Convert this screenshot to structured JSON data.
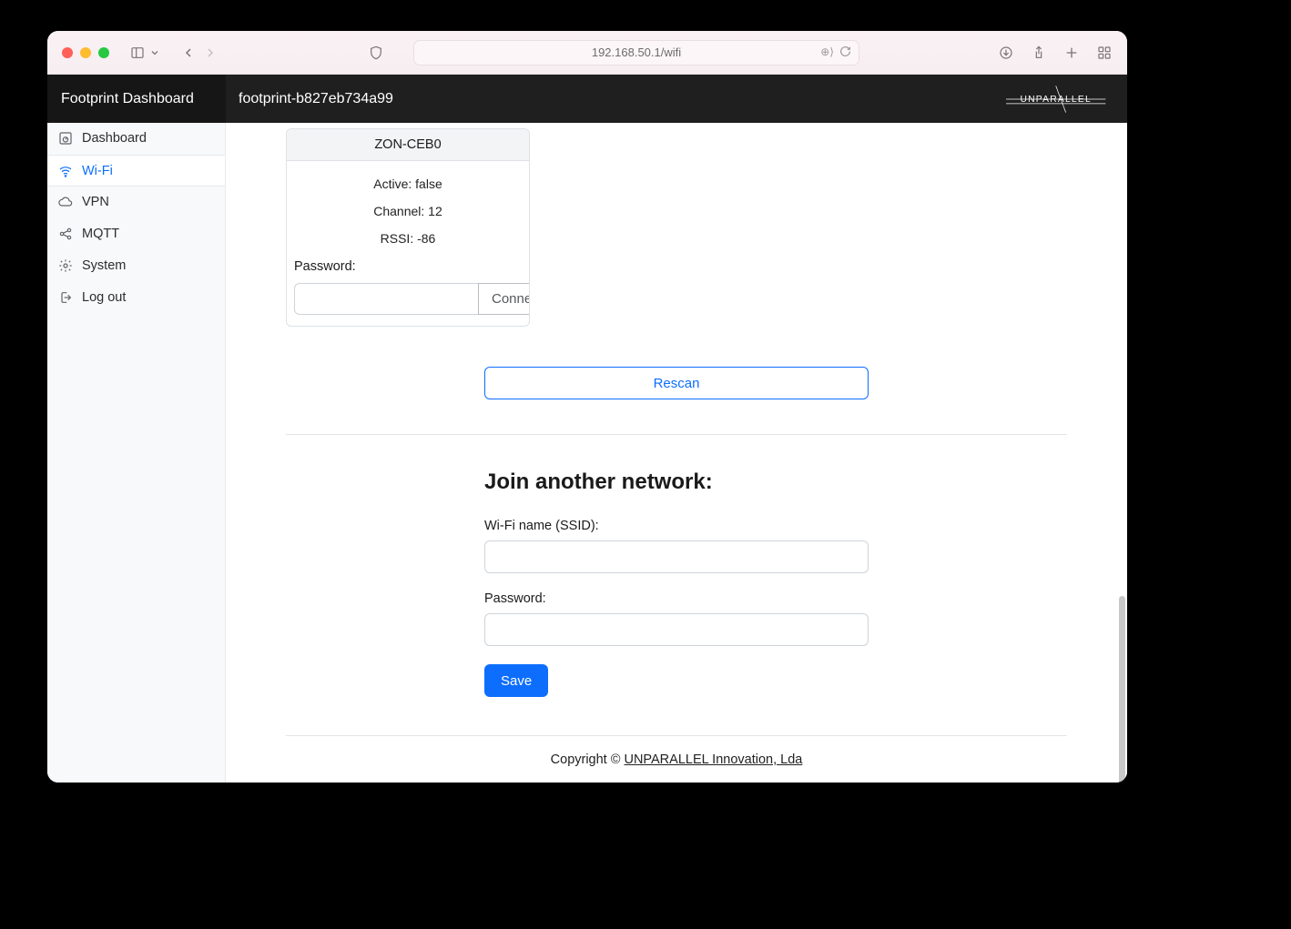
{
  "browser": {
    "url": "192.168.50.1/wifi"
  },
  "header": {
    "brand": "Footprint Dashboard",
    "hostname": "footprint-b827eb734a99",
    "logo_text": "UNPARALLEL"
  },
  "sidebar": {
    "items": [
      {
        "label": "Dashboard",
        "icon": "gauge-icon",
        "active": false
      },
      {
        "label": "Wi-Fi",
        "icon": "wifi-icon",
        "active": true
      },
      {
        "label": "VPN",
        "icon": "cloud-icon",
        "active": false
      },
      {
        "label": "MQTT",
        "icon": "share-icon",
        "active": false
      },
      {
        "label": "System",
        "icon": "gear-icon",
        "active": false
      },
      {
        "label": "Log out",
        "icon": "logout-icon",
        "active": false
      }
    ]
  },
  "network_card": {
    "ssid": "ZON-CEB0",
    "active_label": "Active:",
    "active_value": "false",
    "channel_label": "Channel:",
    "channel_value": "12",
    "rssi_label": "RSSI:",
    "rssi_value": "-86",
    "password_label": "Password:",
    "connect_label": "Connect"
  },
  "rescan_label": "Rescan",
  "join": {
    "heading": "Join another network:",
    "ssid_label": "Wi-Fi name (SSID):",
    "password_label": "Password:",
    "save_label": "Save"
  },
  "footer": {
    "copyright": "Copyright © ",
    "link": "UNPARALLEL Innovation, Lda"
  }
}
